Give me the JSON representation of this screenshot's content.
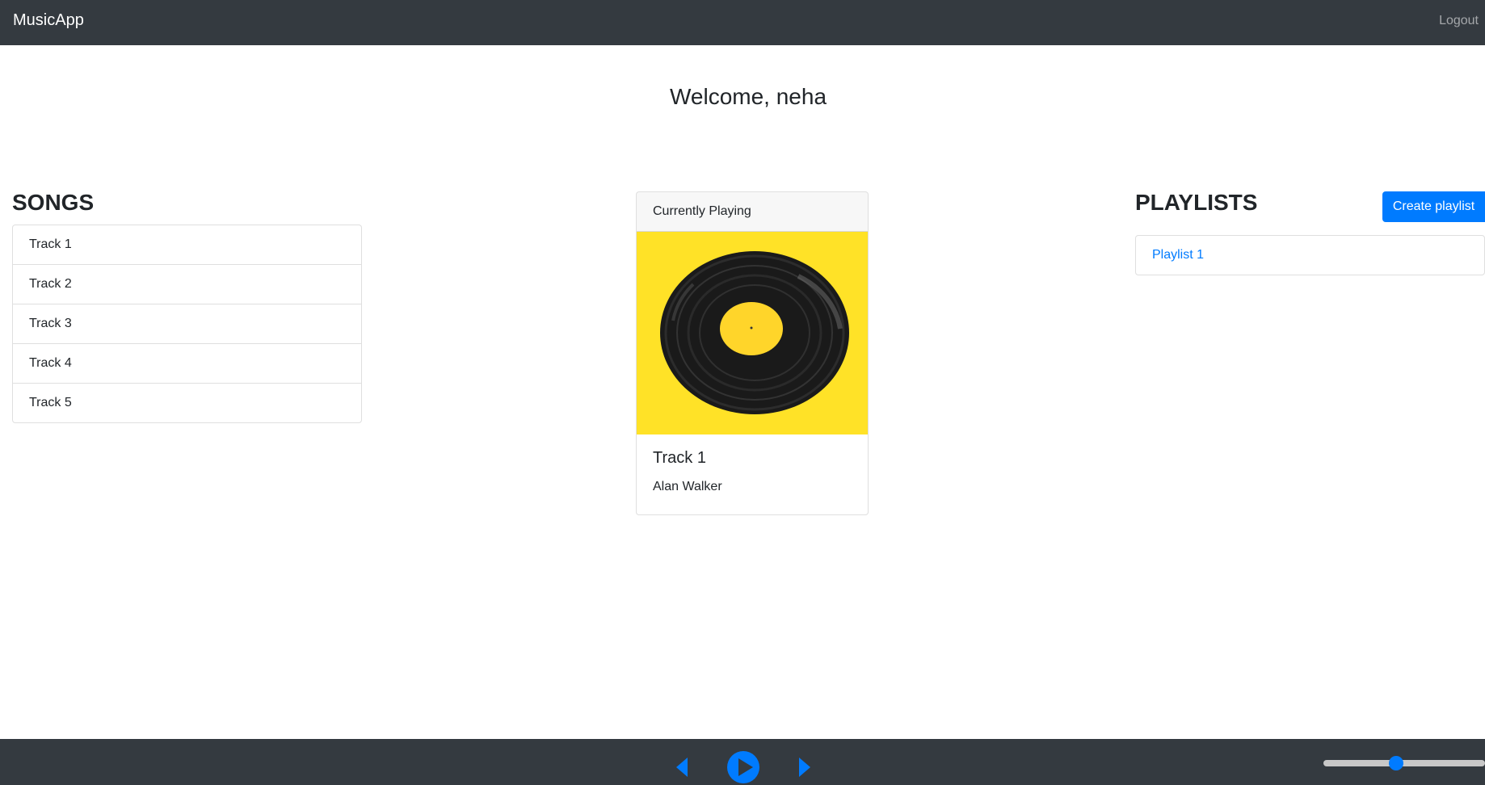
{
  "navbar": {
    "brand": "MusicApp",
    "logout": "Logout"
  },
  "welcome": "Welcome, neha",
  "songs": {
    "title": "SONGS",
    "items": [
      "Track 1",
      "Track 2",
      "Track 3",
      "Track 4",
      "Track 5"
    ]
  },
  "now_playing": {
    "header": "Currently Playing",
    "track": "Track 1",
    "artist": "Alan Walker",
    "artwork_icon": "vinyl-record-icon"
  },
  "playlists": {
    "title": "PLAYLISTS",
    "create_label": "Create playlist",
    "items": [
      "Playlist 1"
    ]
  },
  "player": {
    "prev_icon": "prev-icon",
    "play_icon": "play-icon",
    "next_icon": "next-icon",
    "volume": 0.45
  },
  "colors": {
    "navbar": "#343a40",
    "accent": "#007bff",
    "artwork_bg": "#ffe227"
  }
}
